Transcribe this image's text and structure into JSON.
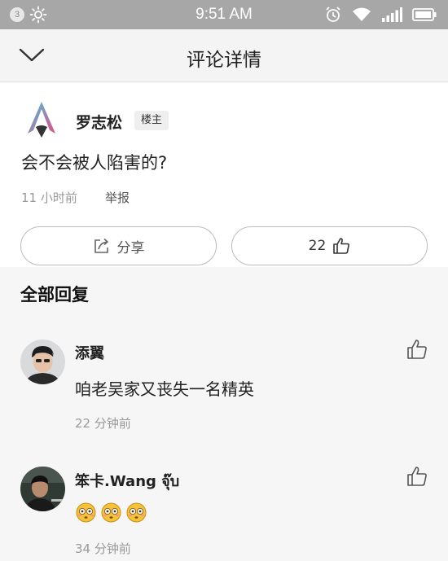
{
  "status_bar": {
    "notification_count": "3",
    "time": "9:51 AM"
  },
  "nav": {
    "title": "评论详情"
  },
  "comment": {
    "author": "罗志松",
    "badge": "楼主",
    "text": "会不会被人陷害的?",
    "time": "11 小时前",
    "report_label": "举报",
    "share_label": "分享",
    "like_count": "22"
  },
  "replies_section": {
    "title": "全部回复",
    "items": [
      {
        "author": "添翼",
        "text": "咱老吴家又丧失一名精英",
        "time": "22 分钟前"
      },
      {
        "author": "笨卡.Wang จุ๊บ",
        "emojis": [
          "flushed-face",
          "flushed-face",
          "flushed-face"
        ],
        "time": "34 分钟前"
      }
    ]
  },
  "colors": {
    "status_bar": "#a7a7a7",
    "background": "#f6f6f6",
    "card": "#ffffff",
    "muted_text": "#999999"
  }
}
